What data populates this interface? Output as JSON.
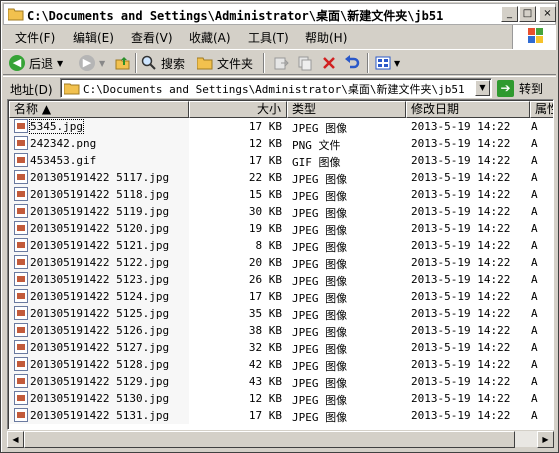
{
  "window": {
    "title": "C:\\Documents and Settings\\Administrator\\桌面\\新建文件夹\\jb51",
    "min_label": "_",
    "max_label": "□",
    "close_label": "×"
  },
  "menu": [
    {
      "label": "文件(F)"
    },
    {
      "label": "编辑(E)"
    },
    {
      "label": "查看(V)"
    },
    {
      "label": "收藏(A)"
    },
    {
      "label": "工具(T)"
    },
    {
      "label": "帮助(H)"
    }
  ],
  "toolbar": {
    "back_label": "后退",
    "search_label": "搜索",
    "folders_label": "文件夹"
  },
  "address": {
    "label": "地址(D)",
    "value": "C:\\Documents and Settings\\Administrator\\桌面\\新建文件夹\\jb51",
    "go_label": "转到"
  },
  "columns": {
    "name": "名称 ▲",
    "size": "大小",
    "type": "类型",
    "date": "修改日期",
    "attr": "属性"
  },
  "files": [
    {
      "name": "5345.jpg",
      "size": "17 KB",
      "type": "JPEG 图像",
      "date": "2013-5-19 14:22",
      "attr": "A"
    },
    {
      "name": "242342.png",
      "size": "12 KB",
      "type": "PNG 文件",
      "date": "2013-5-19 14:22",
      "attr": "A"
    },
    {
      "name": "453453.gif",
      "size": "17 KB",
      "type": "GIF 图像",
      "date": "2013-5-19 14:22",
      "attr": "A"
    },
    {
      "name": "201305191422 5117.jpg",
      "size": "22 KB",
      "type": "JPEG 图像",
      "date": "2013-5-19 14:22",
      "attr": "A"
    },
    {
      "name": "201305191422 5118.jpg",
      "size": "15 KB",
      "type": "JPEG 图像",
      "date": "2013-5-19 14:22",
      "attr": "A"
    },
    {
      "name": "201305191422 5119.jpg",
      "size": "30 KB",
      "type": "JPEG 图像",
      "date": "2013-5-19 14:22",
      "attr": "A"
    },
    {
      "name": "201305191422 5120.jpg",
      "size": "19 KB",
      "type": "JPEG 图像",
      "date": "2013-5-19 14:22",
      "attr": "A"
    },
    {
      "name": "201305191422 5121.jpg",
      "size": "8 KB",
      "type": "JPEG 图像",
      "date": "2013-5-19 14:22",
      "attr": "A"
    },
    {
      "name": "201305191422 5122.jpg",
      "size": "20 KB",
      "type": "JPEG 图像",
      "date": "2013-5-19 14:22",
      "attr": "A"
    },
    {
      "name": "201305191422 5123.jpg",
      "size": "26 KB",
      "type": "JPEG 图像",
      "date": "2013-5-19 14:22",
      "attr": "A"
    },
    {
      "name": "201305191422 5124.jpg",
      "size": "17 KB",
      "type": "JPEG 图像",
      "date": "2013-5-19 14:22",
      "attr": "A"
    },
    {
      "name": "201305191422 5125.jpg",
      "size": "35 KB",
      "type": "JPEG 图像",
      "date": "2013-5-19 14:22",
      "attr": "A"
    },
    {
      "name": "201305191422 5126.jpg",
      "size": "38 KB",
      "type": "JPEG 图像",
      "date": "2013-5-19 14:22",
      "attr": "A"
    },
    {
      "name": "201305191422 5127.jpg",
      "size": "32 KB",
      "type": "JPEG 图像",
      "date": "2013-5-19 14:22",
      "attr": "A"
    },
    {
      "name": "201305191422 5128.jpg",
      "size": "42 KB",
      "type": "JPEG 图像",
      "date": "2013-5-19 14:22",
      "attr": "A"
    },
    {
      "name": "201305191422 5129.jpg",
      "size": "43 KB",
      "type": "JPEG 图像",
      "date": "2013-5-19 14:22",
      "attr": "A"
    },
    {
      "name": "201305191422 5130.jpg",
      "size": "12 KB",
      "type": "JPEG 图像",
      "date": "2013-5-19 14:22",
      "attr": "A"
    },
    {
      "name": "201305191422 5131.jpg",
      "size": "17 KB",
      "type": "JPEG 图像",
      "date": "2013-5-19 14:22",
      "attr": "A"
    }
  ],
  "colors": {
    "face": "#d4d0c8",
    "list_bg": "#ffffff",
    "name_col_bg": "#f7f7f7",
    "go_green": "#2f9a2f"
  }
}
